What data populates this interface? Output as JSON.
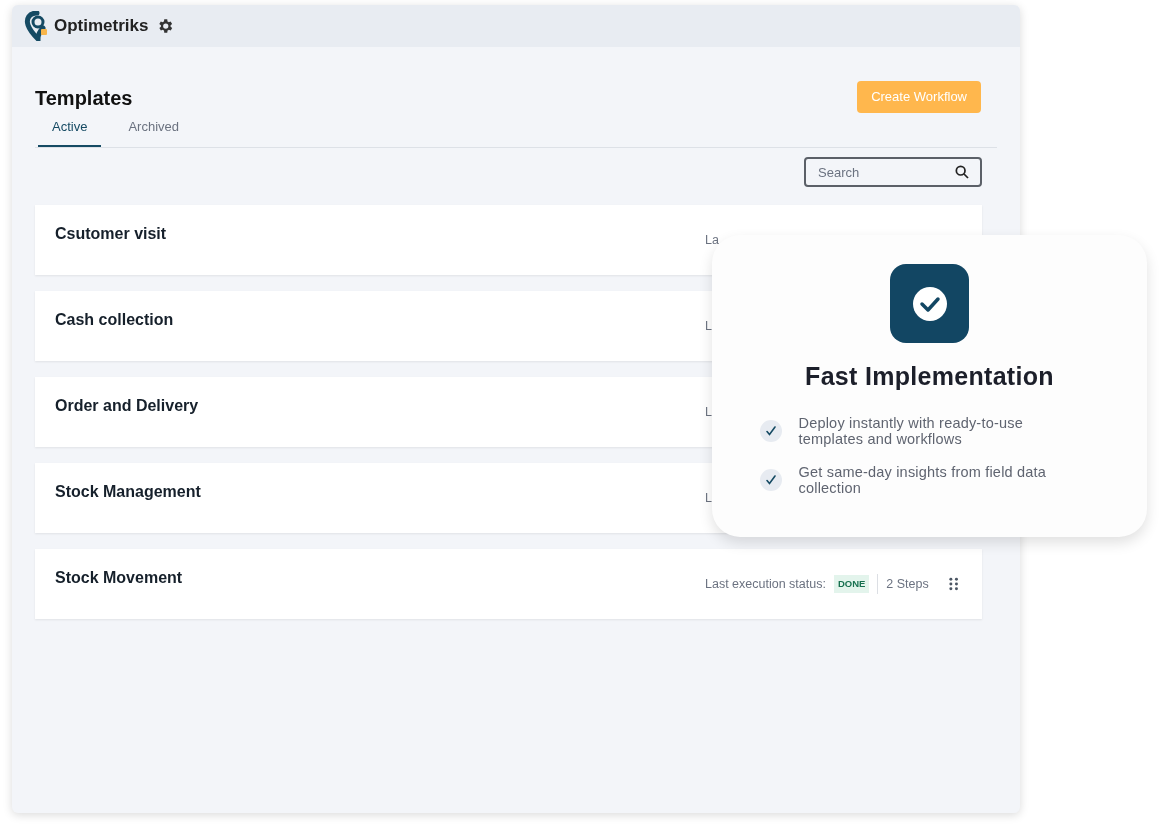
{
  "header": {
    "brand": "Optimetriks"
  },
  "page": {
    "title": "Templates",
    "create_button": "Create Workflow"
  },
  "tabs": [
    {
      "label": "Active",
      "selected": true
    },
    {
      "label": "Archived",
      "selected": false
    }
  ],
  "search": {
    "placeholder": "Search"
  },
  "templates": [
    {
      "name": "Csutomer visit",
      "status_label": "La"
    },
    {
      "name": "Cash collection",
      "status_label": "L"
    },
    {
      "name": "Order and Delivery",
      "status_label": "L"
    },
    {
      "name": "Stock Management",
      "status_label": "L"
    },
    {
      "name": "Stock Movement",
      "status_label": "Last execution status:",
      "status": "DONE",
      "steps": "2 Steps"
    }
  ],
  "feature_card": {
    "title": "Fast Implementation",
    "points": [
      "Deploy instantly with ready-to-use templates and workflows",
      "Get same-day insights from field data collection"
    ]
  }
}
